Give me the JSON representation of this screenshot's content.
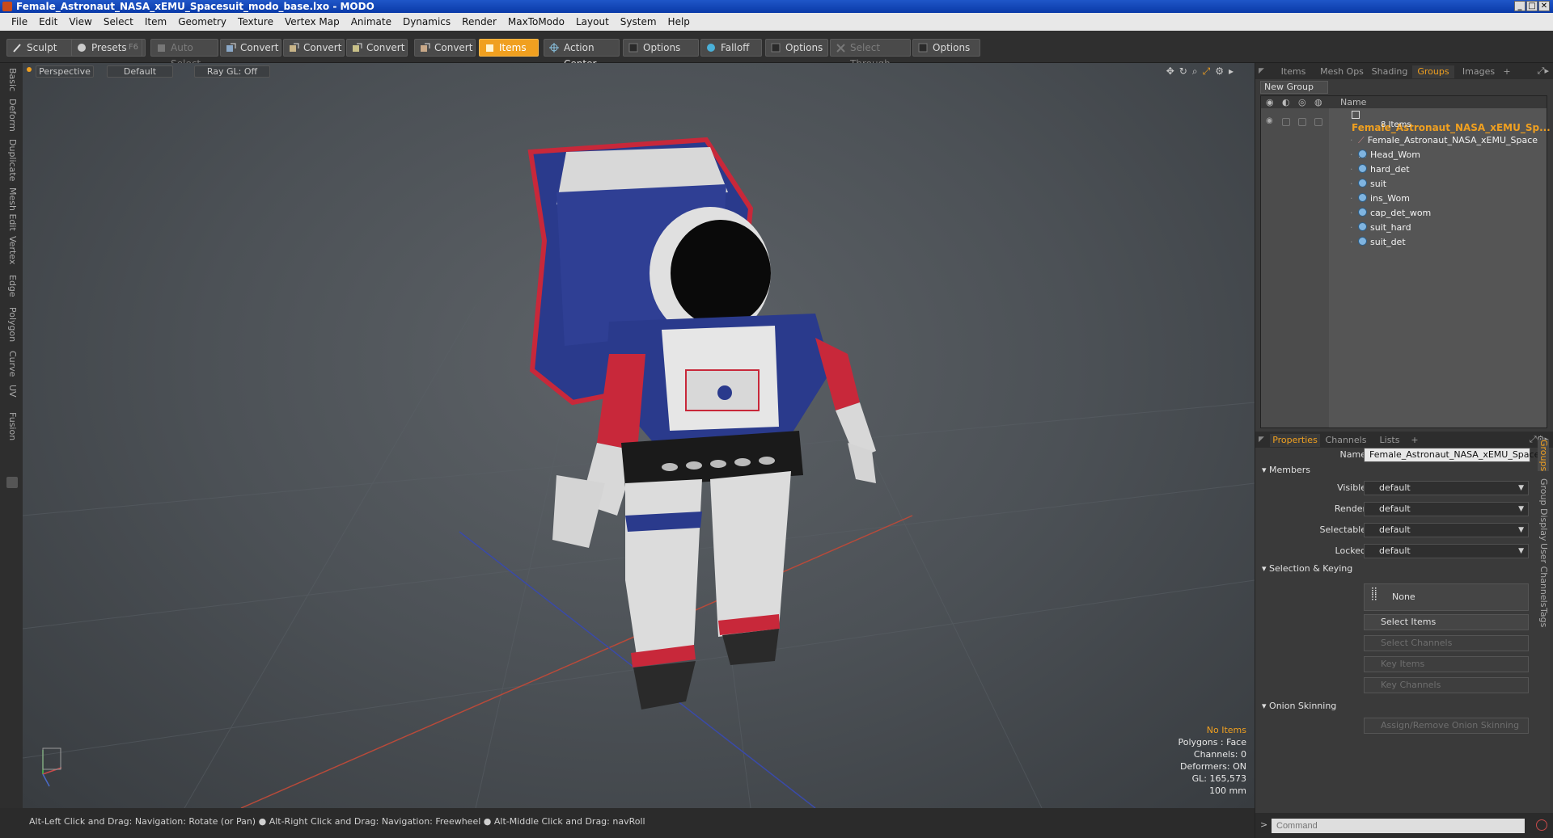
{
  "window": {
    "title": "Female_Astronaut_NASA_xEMU_Spacesuit_modo_base.lxo - MODO",
    "controls": [
      "_",
      "□",
      "✕"
    ]
  },
  "menu": [
    "File",
    "Edit",
    "View",
    "Select",
    "Item",
    "Geometry",
    "Texture",
    "Vertex Map",
    "Animate",
    "Dynamics",
    "Render",
    "MaxToModo",
    "Layout",
    "System",
    "Help"
  ],
  "toolbar": {
    "sculpt": "Sculpt",
    "presets": "Presets",
    "presets_key": "F6",
    "auto_select": "Auto Select",
    "convert1": "Convert",
    "convert2": "Convert",
    "convert3": "Convert",
    "convert4": "Convert",
    "items": "Items",
    "action_center": "Action Center",
    "options1": "Options",
    "falloff": "Falloff",
    "options2": "Options",
    "select_through": "Select Through",
    "options3": "Options"
  },
  "left_tabs": [
    "Basic",
    "Deform",
    "Duplicate",
    "Mesh Edit",
    "Vertex",
    "Edge",
    "Polygon",
    "Curve",
    "UV",
    "Fusion"
  ],
  "viewport": {
    "view": "Perspective",
    "shading": "Default",
    "raygl": "Ray GL: Off",
    "stats": {
      "selection": "No Items",
      "polygons": "Polygons : Face",
      "channels": "Channels: 0",
      "deformers": "Deformers: ON",
      "gl": "GL: 165,573",
      "grid": "100 mm"
    },
    "colors": {
      "suit_red": "#c8283a",
      "suit_blue": "#2a3a8c",
      "suit_white": "#d8d8d8",
      "axis_red": "#b84a3a",
      "axis_blue": "#3a4aa8"
    }
  },
  "statusbar": "Alt-Left Click and Drag: Navigation: Rotate (or Pan) ● Alt-Right Click and Drag: Navigation: Freewheel ● Alt-Middle Click and Drag: navRoll",
  "right_tabs_top": [
    "Items",
    "Mesh Ops",
    "Shading",
    "Groups",
    "Images",
    "+"
  ],
  "groups": {
    "new_group": "New Group",
    "col_name": "Name",
    "root": "Female_Astronaut_NASA_xEMU_Sp...",
    "root_count": "8 Items",
    "children": [
      "Female_Astronaut_NASA_xEMU_Space ...",
      "Head_Wom",
      "hard_det",
      "suit",
      "ins_Wom",
      "cap_det_wom",
      "suit_hard",
      "suit_det"
    ]
  },
  "right_tabs_bottom": [
    "Properties",
    "Channels",
    "Lists",
    "+"
  ],
  "properties": {
    "name_label": "Name",
    "name_value": "Female_Astronaut_NASA_xEMU_Spaces",
    "members": "Members",
    "visible_label": "Visible",
    "visible": "default",
    "render_label": "Render",
    "render": "default",
    "selectable_label": "Selectable",
    "selectable": "default",
    "locked_label": "Locked",
    "locked": "default",
    "sel_keying": "Selection & Keying",
    "none": "None",
    "select_items": "Select Items",
    "select_channels": "Select Channels",
    "key_items": "Key Items",
    "key_channels": "Key Channels",
    "onion": "Onion Skinning",
    "assign_onion": "Assign/Remove Onion Skinning"
  },
  "side_vtabs": [
    "Groups",
    "Group Display",
    "User Channels",
    "Tags"
  ],
  "command": {
    "placeholder": "Command"
  }
}
